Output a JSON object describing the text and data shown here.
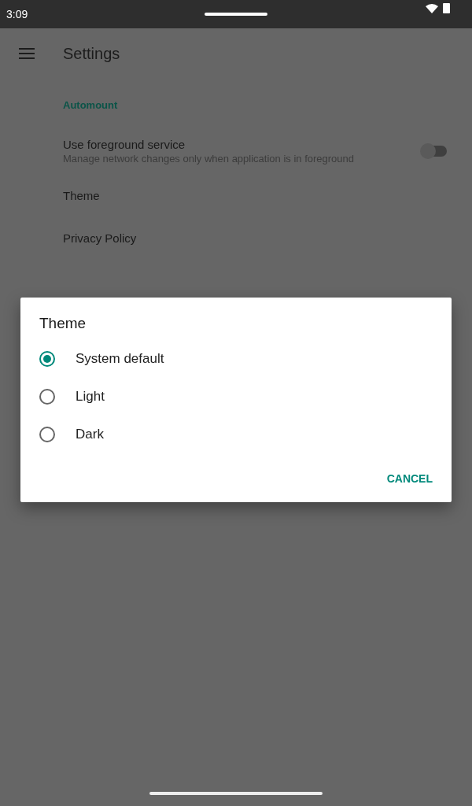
{
  "status_bar": {
    "time": "3:09"
  },
  "app_bar": {
    "title": "Settings"
  },
  "category": "Automount",
  "settings": [
    {
      "kind": "switch",
      "title": "Use foreground service",
      "summary": "Manage network changes only when application is in foreground",
      "on": false
    },
    {
      "kind": "plain",
      "title": "Theme"
    },
    {
      "kind": "plain",
      "title": "Privacy Policy"
    }
  ],
  "dialog": {
    "title": "Theme",
    "options": [
      {
        "label": "System default",
        "selected": true
      },
      {
        "label": "Light",
        "selected": false
      },
      {
        "label": "Dark",
        "selected": false
      }
    ],
    "button": "CANCEL"
  }
}
